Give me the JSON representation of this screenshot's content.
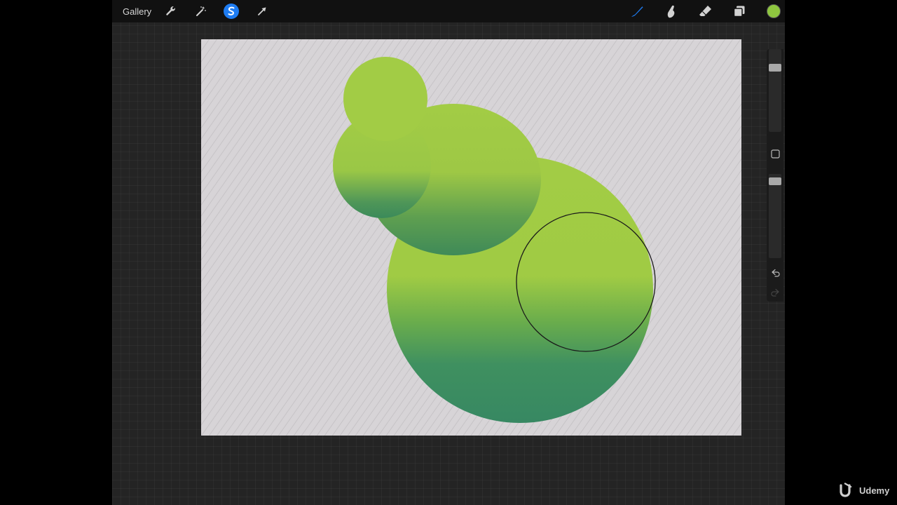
{
  "toolbar": {
    "gallery_label": "Gallery",
    "left_icons": [
      "wrench-icon",
      "magic-wand-icon",
      "selection-icon",
      "transform-arrow-icon"
    ],
    "right_icons": [
      "brush-icon",
      "smudge-icon",
      "eraser-icon",
      "layers-icon",
      "color-swatch"
    ]
  },
  "colors": {
    "active_tool": "#1e7cf2",
    "current_color": "#8ec63f",
    "canvas_background": "#d7d4d7",
    "shape_light": "#a2cc45",
    "shape_dark": "#3a8a62"
  },
  "sidebar": {
    "brush_size_level": 0.2,
    "opacity_level": 0.05,
    "icons": [
      "modify-square-icon",
      "undo-icon",
      "redo-icon"
    ]
  },
  "watermark": {
    "brand": "Udemy"
  }
}
